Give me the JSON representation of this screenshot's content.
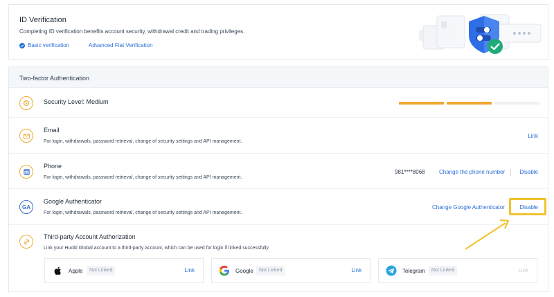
{
  "id_verification": {
    "title": "ID Verification",
    "description": "Completing ID verification benefits account security, withdrawal credit and trading privileges.",
    "basic_link": "Basic verification",
    "advanced_link": "Advanced Fiat Verification"
  },
  "two_factor": {
    "header": "Two-factor Authentication",
    "security_level": {
      "label": "Security Level: Medium",
      "filled_segments": 2,
      "total_segments": 3,
      "colors": {
        "filled": "#f0a830",
        "empty": "#eef0f3"
      }
    },
    "email": {
      "title": "Email",
      "description": "For login, withdrawals, password retrieval, change of security settings and API management.",
      "action": "Link"
    },
    "phone": {
      "title": "Phone",
      "description": "For login, withdrawals, password retrieval, change of security settings and API management.",
      "number": "981****8068",
      "change_action": "Change the phone number",
      "disable_action": "Disable"
    },
    "google_auth": {
      "icon_text": "GA",
      "title": "Google Authenticator",
      "description": "For login, withdrawals, password retrieval, change of security settings and API management.",
      "change_action": "Change Google Authenticator",
      "disable_action": "Disable"
    },
    "third_party": {
      "title": "Third-party Account Authorization",
      "description": "Link your Huobi Global account to a third-party account, which can be used for login if linked successfully.",
      "accounts": [
        {
          "name": "Apple",
          "status": "Not Linked",
          "action": "Link",
          "icon": "apple-icon"
        },
        {
          "name": "Google",
          "status": "Not Linked",
          "action": "Link",
          "icon": "google-icon"
        },
        {
          "name": "Telegram",
          "status": "Not Linked",
          "action": "Link",
          "icon": "telegram-icon"
        }
      ]
    }
  },
  "colors": {
    "accent_blue": "#2b6fd6",
    "accent_orange": "#f0a830",
    "highlight_yellow": "#f2c230"
  }
}
